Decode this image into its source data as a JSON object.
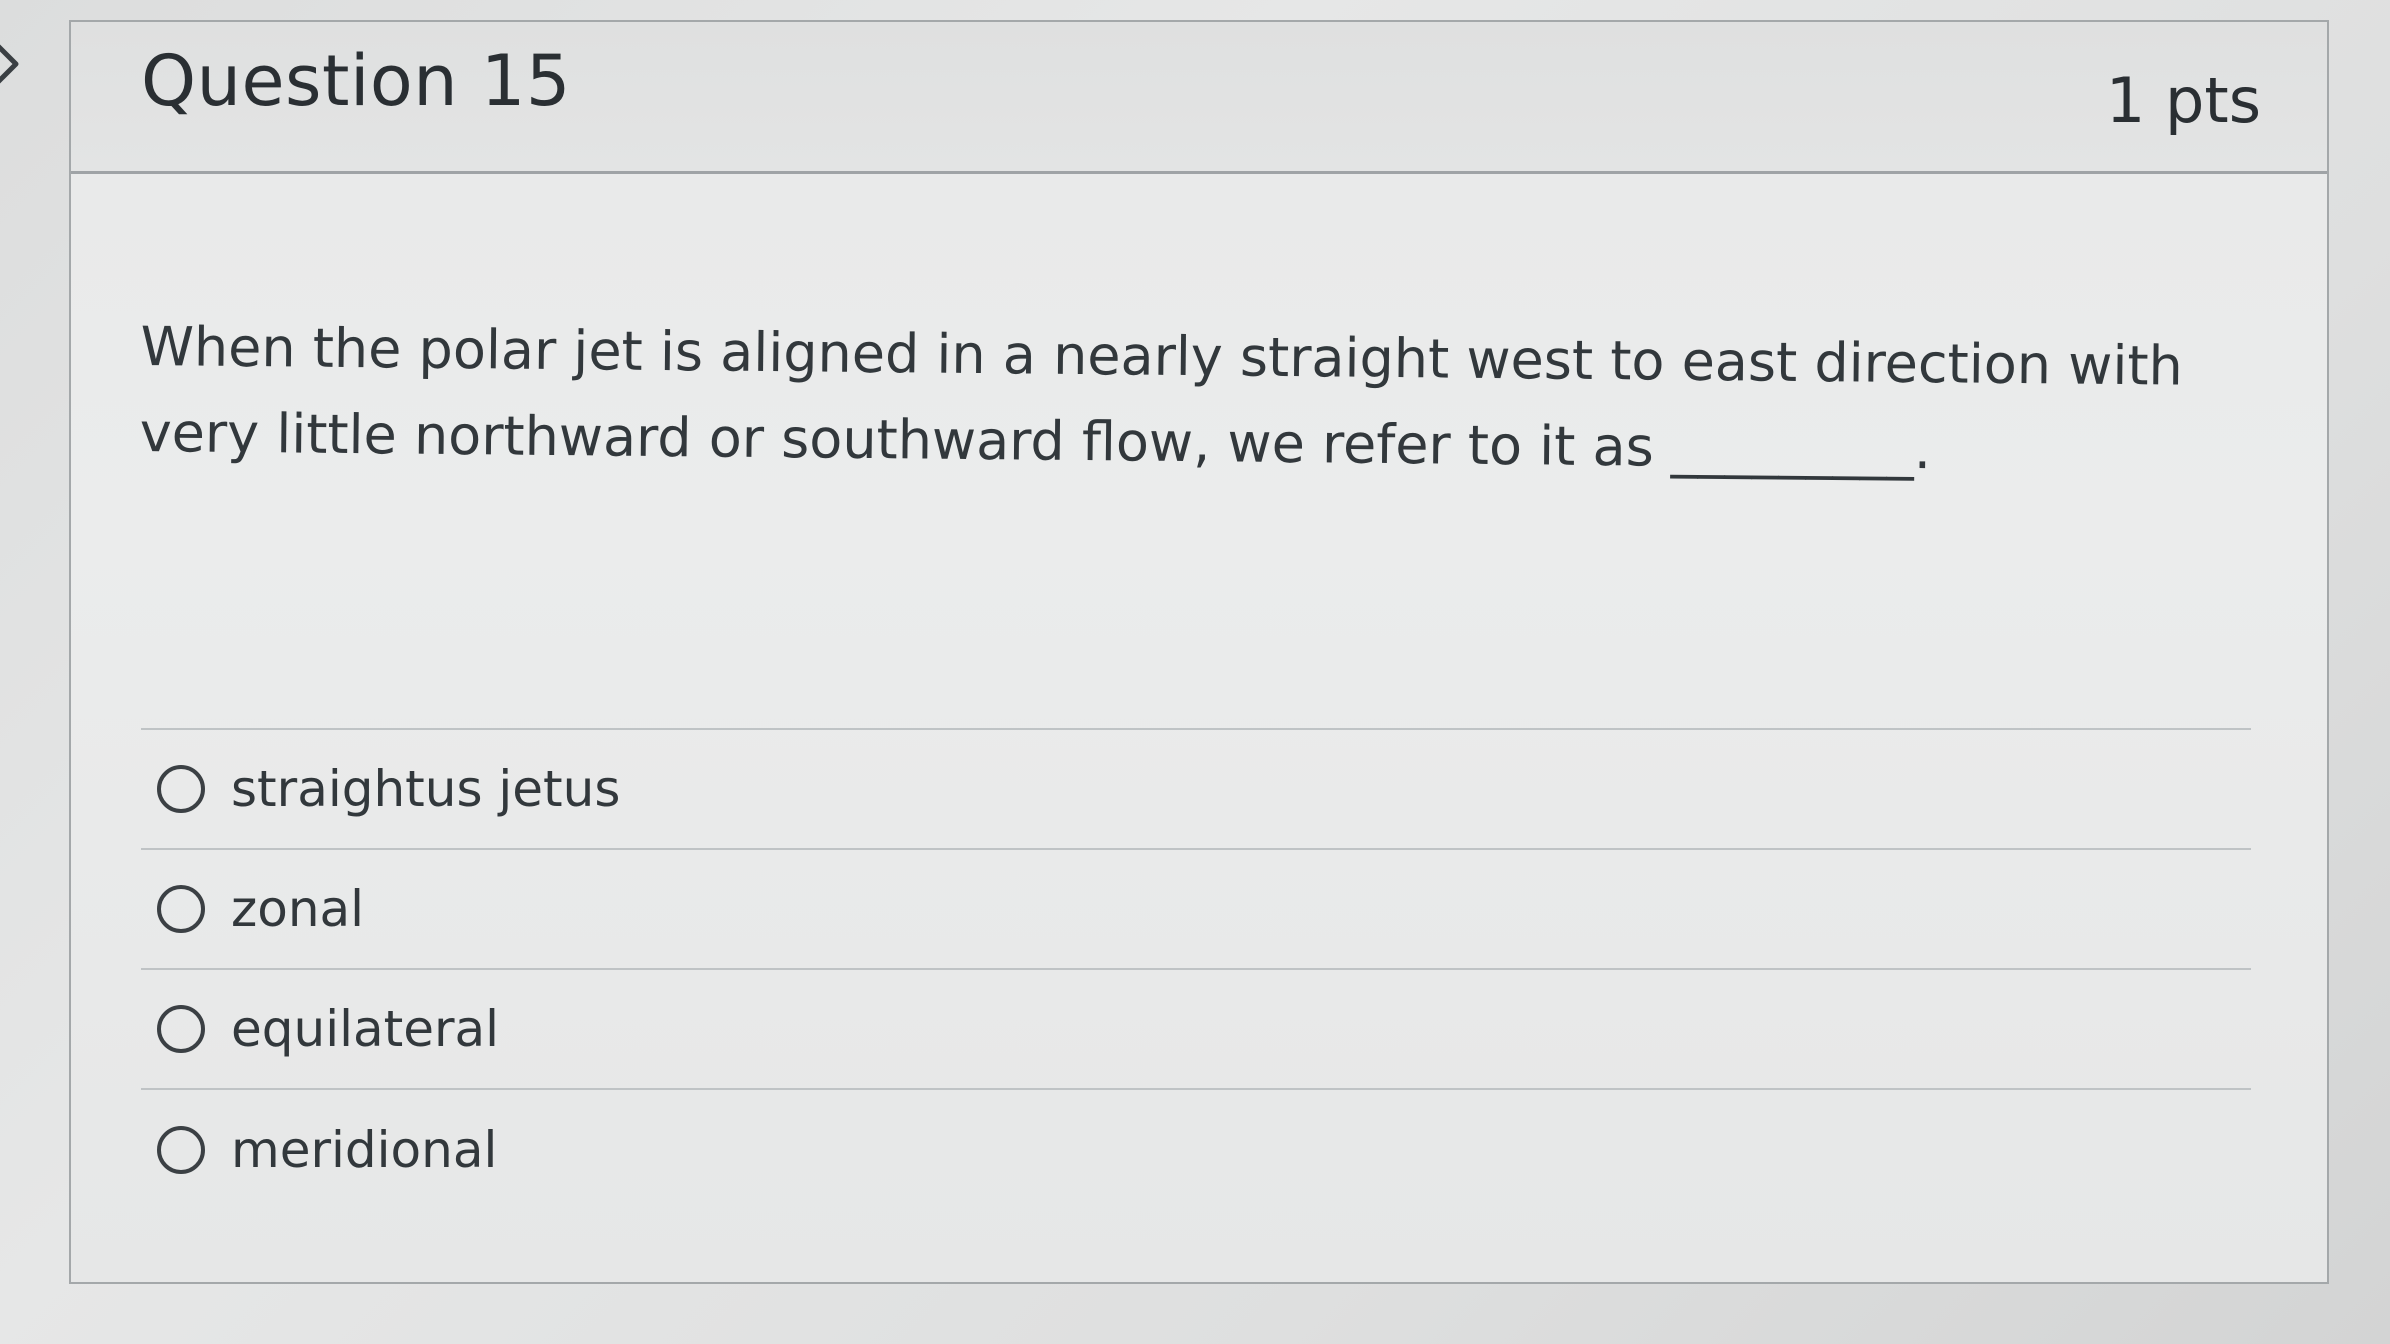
{
  "question": {
    "title": "Question 15",
    "points": "1 pts",
    "text": "When the polar jet is aligned in a nearly straight west to east direction with very little northward or southward flow, we refer to it as _________.",
    "answers": [
      {
        "label": "straightus jetus"
      },
      {
        "label": "zonal"
      },
      {
        "label": "equilateral"
      },
      {
        "label": "meridional"
      }
    ]
  },
  "colors": {
    "card_border": "#a4a8aa",
    "text": "#32383c",
    "divider": "#bfc3c5"
  },
  "icons": {
    "side_nav": "chevron-right-icon",
    "answer_radio": "radio-button-icon"
  }
}
